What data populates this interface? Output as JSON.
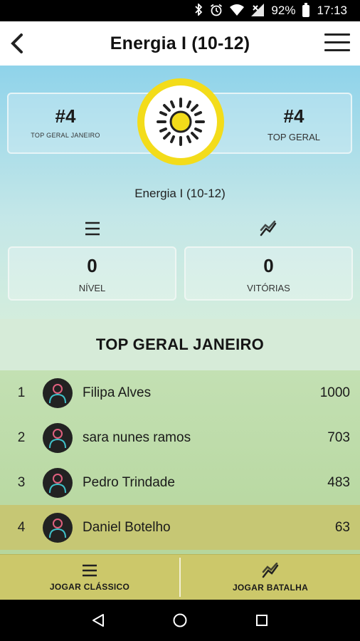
{
  "status_bar": {
    "battery": "92%",
    "time": "17:13",
    "icons": [
      "bluetooth-icon",
      "alarm-icon",
      "wifi-icon",
      "no-signal-icon",
      "battery-icon"
    ]
  },
  "app_bar": {
    "title": "Energia I (10-12)",
    "back_icon": "chevron-left-icon",
    "menu_icon": "hamburger-menu-icon"
  },
  "hero": {
    "left": {
      "value": "#4",
      "label": "TOP GERAL JANEIRO"
    },
    "right": {
      "value": "#4",
      "label": "TOP GERAL"
    },
    "badge_icon": "sun-icon",
    "subject": "Energia I (10-12)",
    "stats": [
      {
        "icon": "list-icon",
        "value": "0",
        "label": "NÍVEL"
      },
      {
        "icon": "trend-icon",
        "value": "0",
        "label": "VITÓRIAS"
      }
    ]
  },
  "leaderboard": {
    "title": "TOP GERAL JANEIRO",
    "rows": [
      {
        "position": "1",
        "name": "Filipa Alves",
        "score": "1000"
      },
      {
        "position": "2",
        "name": "sara nunes ramos",
        "score": "703"
      },
      {
        "position": "3",
        "name": "Pedro Trindade",
        "score": "483"
      },
      {
        "position": "4",
        "name": "Daniel Botelho",
        "score": "63",
        "highlighted": true
      }
    ]
  },
  "bottom_nav": {
    "classic": {
      "label": "JOGAR CLÁSSICO",
      "icon": "list-icon"
    },
    "battle": {
      "label": "JOGAR BATALHA",
      "icon": "trend-icon"
    }
  },
  "colors": {
    "accent_yellow": "#f3dc1a",
    "highlight_row": "#c6c774",
    "bottom_nav": "#ccc86a"
  }
}
